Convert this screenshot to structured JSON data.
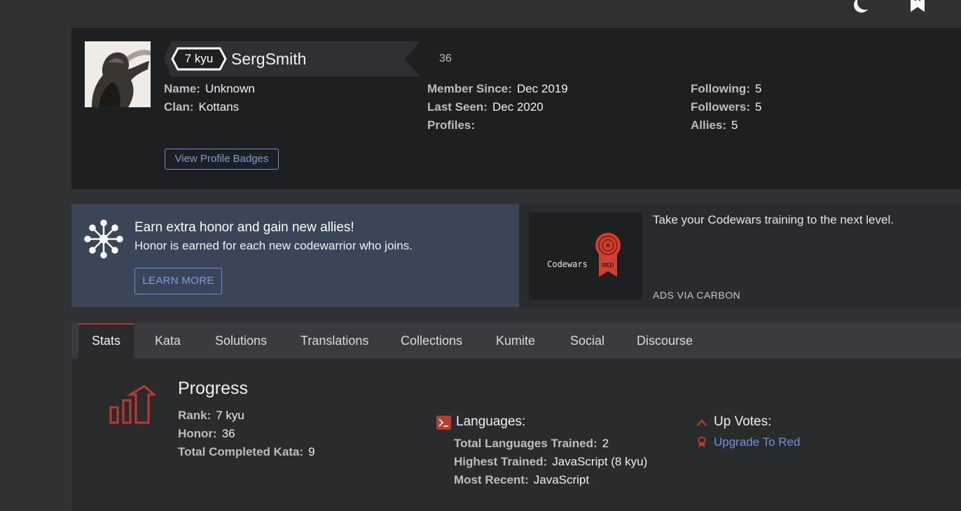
{
  "topbar": {
    "theme_icon": "moon-icon",
    "bookmark_icon": "bookmark-icon"
  },
  "profile": {
    "rank": "7 kyu",
    "username": "SergSmith",
    "honor": "36",
    "col1": [
      {
        "label": "Name:",
        "value": "Unknown"
      },
      {
        "label": "Clan:",
        "value": "Kottans"
      }
    ],
    "col2": [
      {
        "label": "Member Since:",
        "value": "Dec 2019"
      },
      {
        "label": "Last Seen:",
        "value": "Dec 2020"
      },
      {
        "label": "Profiles:",
        "value": ""
      }
    ],
    "col3": [
      {
        "label": "Following:",
        "value": "5"
      },
      {
        "label": "Followers:",
        "value": "5"
      },
      {
        "label": "Allies:",
        "value": "5"
      }
    ],
    "badges_button": "View Profile Badges"
  },
  "promo": {
    "title": "Earn extra honor and gain new allies!",
    "text": "Honor is earned for each new codewarrior who joins.",
    "button": "LEARN MORE"
  },
  "ad": {
    "logo_text": "Codewars",
    "text": "Take your Codewars training to the next level.",
    "via": "ADS VIA CARBON",
    "badge_text": "RED"
  },
  "tabs": [
    "Stats",
    "Kata",
    "Solutions",
    "Translations",
    "Collections",
    "Kumite",
    "Social",
    "Discourse"
  ],
  "stats": {
    "progress_title": "Progress",
    "progress": [
      {
        "label": "Rank:",
        "value": "7 kyu"
      },
      {
        "label": "Honor:",
        "value": "36"
      },
      {
        "label": "Total Completed Kata:",
        "value": "9"
      }
    ],
    "languages_title": "Languages:",
    "languages": [
      {
        "label": "Total Languages Trained:",
        "value": "2"
      },
      {
        "label": "Highest Trained:",
        "value": "JavaScript (8 kyu)"
      },
      {
        "label": "Most Recent:",
        "value": "JavaScript"
      }
    ],
    "votes_title": "Up Votes:",
    "votes_link": "Upgrade To Red"
  },
  "colors": {
    "accent_red": "#c0392b",
    "link_blue": "#6b93e0",
    "promo_bg": "#3b4558"
  }
}
